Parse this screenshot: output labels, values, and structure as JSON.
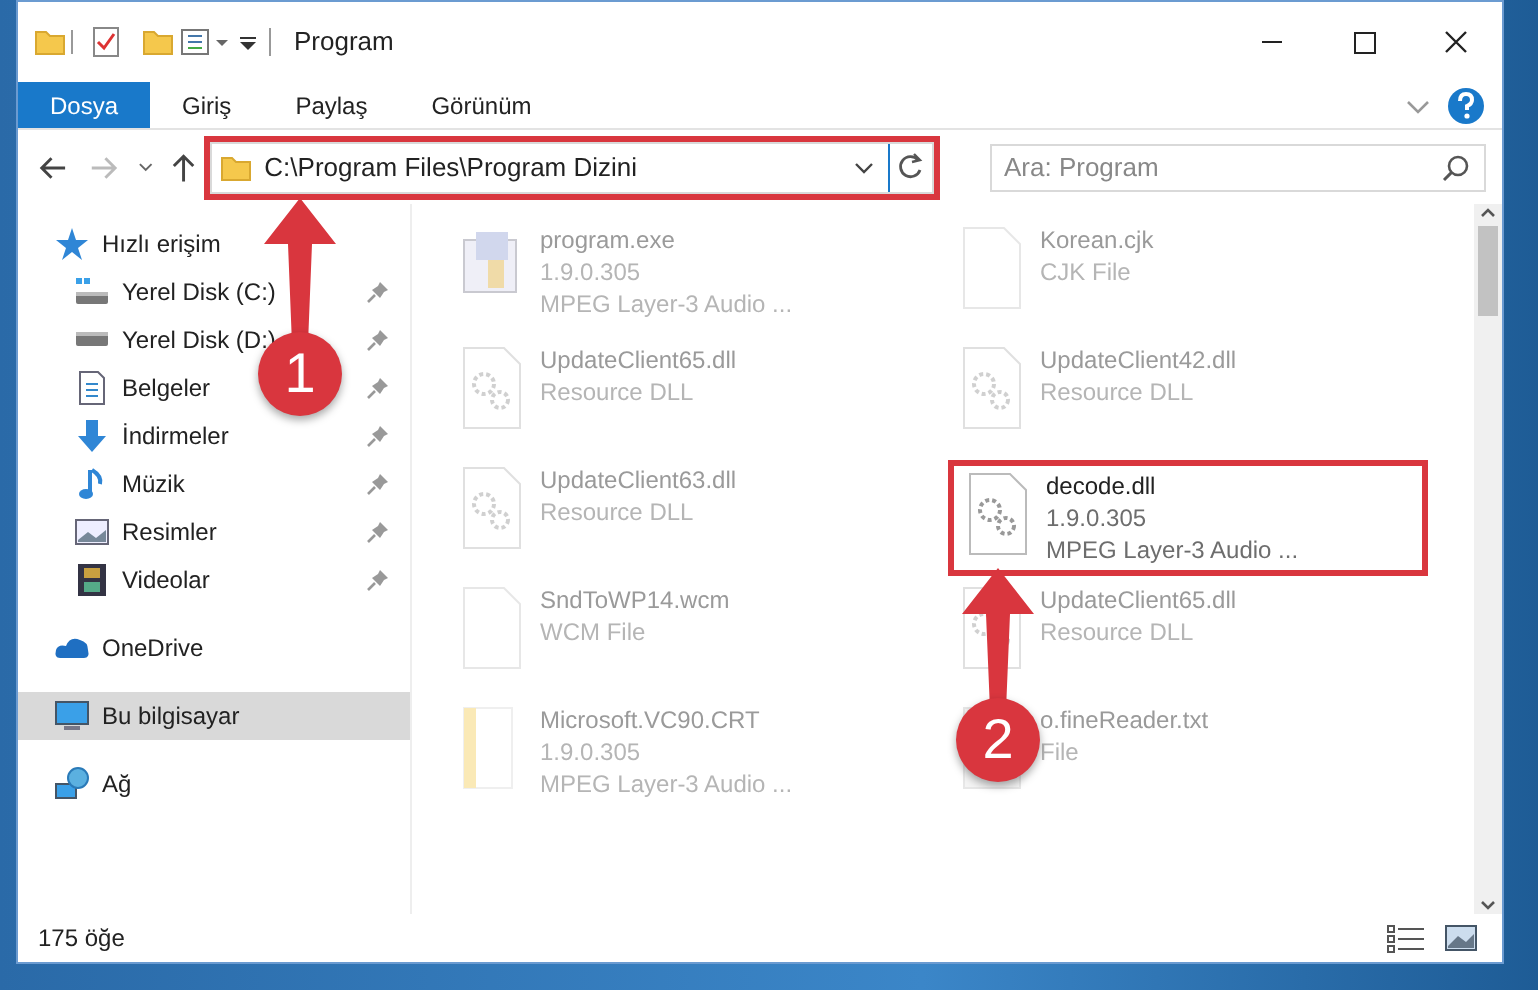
{
  "window": {
    "title": "Program"
  },
  "ribbon_tabs": [
    {
      "label": "Dosya",
      "selected": true
    },
    {
      "label": "Giriş",
      "selected": false
    },
    {
      "label": "Paylaş",
      "selected": false
    },
    {
      "label": "Görünüm",
      "selected": false
    }
  ],
  "address_bar": {
    "path": "C:\\Program Files\\Program Dizini",
    "highlighted": true
  },
  "search": {
    "placeholder": "Ara: Program"
  },
  "sidebar": {
    "items": [
      {
        "label": "Hızlı erişim",
        "kind": "star",
        "selected": false,
        "children": [
          {
            "label": "Yerel Disk (C:)",
            "kind": "drive-c",
            "pinned": true,
            "selected": false
          },
          {
            "label": "Yerel Disk (D:)",
            "kind": "drive",
            "pinned": true,
            "selected": false
          },
          {
            "label": "Belgeler",
            "kind": "document",
            "pinned": true,
            "selected": false
          },
          {
            "label": "İndirmeler",
            "kind": "download",
            "pinned": true,
            "selected": false
          },
          {
            "label": "Müzik",
            "kind": "music",
            "pinned": true,
            "selected": false
          },
          {
            "label": "Resimler",
            "kind": "pictures",
            "pinned": true,
            "selected": false
          },
          {
            "label": "Videolar",
            "kind": "videos",
            "pinned": true,
            "selected": false
          }
        ]
      },
      {
        "label": "OneDrive",
        "kind": "cloud",
        "selected": false
      },
      {
        "label": "Bu bilgisayar",
        "kind": "pc",
        "selected": true
      },
      {
        "label": "Ağ",
        "kind": "network",
        "selected": false
      }
    ]
  },
  "files": [
    {
      "name": "program.exe",
      "details": [
        "1.9.0.305",
        "MPEG Layer-3 Audio ..."
      ],
      "kind": "exe",
      "highlighted": false
    },
    {
      "name": "Korean.cjk",
      "details": [
        "CJK File"
      ],
      "kind": "blank",
      "highlighted": false
    },
    {
      "name": "UpdateClient65.dll",
      "details": [
        "Resource DLL"
      ],
      "kind": "dll",
      "highlighted": false
    },
    {
      "name": "UpdateClient42.dll",
      "details": [
        "Resource DLL"
      ],
      "kind": "dll",
      "highlighted": false
    },
    {
      "name": "UpdateClient63.dll",
      "details": [
        "Resource DLL"
      ],
      "kind": "dll",
      "highlighted": false
    },
    {
      "name": "decode.dll",
      "details": [
        "1.9.0.305",
        "MPEG Layer-3 Audio ..."
      ],
      "kind": "dll",
      "highlighted": true
    },
    {
      "name": "SndToWP14.wcm",
      "details": [
        "WCM File"
      ],
      "kind": "blank",
      "highlighted": false
    },
    {
      "name": "UpdateClient65.dll",
      "details": [
        "Resource DLL"
      ],
      "kind": "dll",
      "highlighted": false
    },
    {
      "name": "Microsoft.VC90.CRT",
      "details": [
        "1.9.0.305",
        "MPEG Layer-3 Audio ..."
      ],
      "kind": "manifest",
      "highlighted": false
    },
    {
      "name": "o.fineReader.txt",
      "details": [
        "File"
      ],
      "kind": "text",
      "highlighted": false
    }
  ],
  "annotations": [
    {
      "label": "1"
    },
    {
      "label": "2"
    }
  ],
  "status_bar": {
    "count": "175 öğe"
  }
}
